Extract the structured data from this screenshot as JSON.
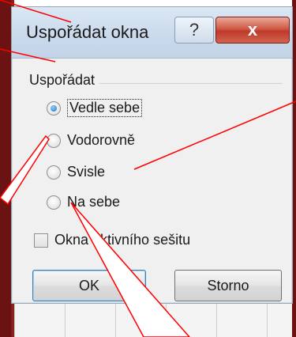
{
  "dialog": {
    "title": "Uspořádat okna",
    "help_label": "?",
    "close_label": "x",
    "group_label": "Uspořádat",
    "options": [
      {
        "label": "Vedle sebe",
        "checked": true
      },
      {
        "label": "Vodorovně",
        "checked": false
      },
      {
        "label": "Svisle",
        "checked": false
      },
      {
        "label": "Na sebe",
        "checked": false
      }
    ],
    "checkbox_label": "Okna aktivního sešitu",
    "ok_label": "OK",
    "cancel_label": "Storno"
  },
  "colors": {
    "frame": "#6b1212",
    "callout": "#ff0000",
    "radio_selected": "#1d6fb8"
  }
}
